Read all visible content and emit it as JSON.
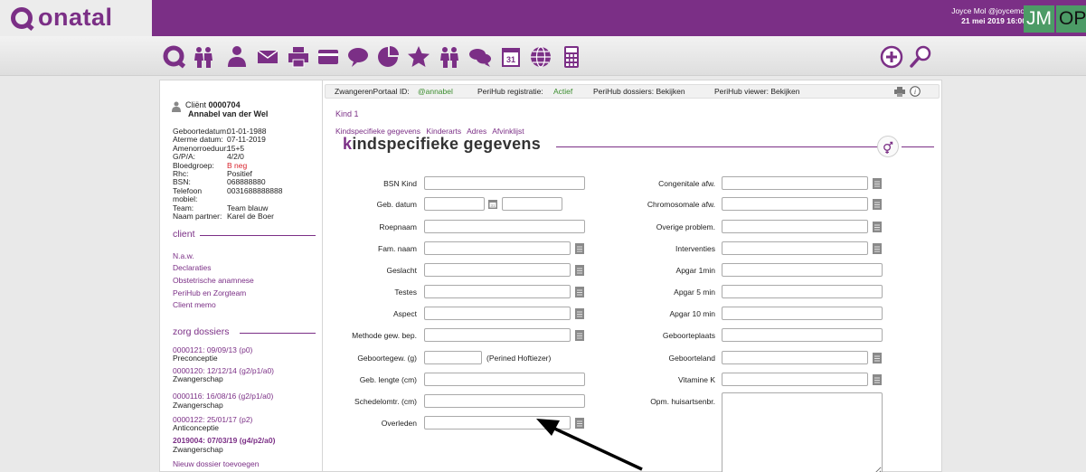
{
  "app": {
    "logo_text": "onatal"
  },
  "user": {
    "name": "Joyce Mol @joycemol",
    "datetime": "21 mei 2019 16:00",
    "initials": "JM",
    "app_badge": "OP"
  },
  "toolbar_icons": [
    "home-q-icon",
    "pregnant-women-icon",
    "client-person-icon",
    "mail-icon",
    "print-icon",
    "card-icon",
    "chat-bubble-icon",
    "pie-chart-icon",
    "star-icon",
    "people-icon",
    "chat-icon",
    "calendar-icon",
    "globe-icon",
    "calculator-icon",
    "add-circle-icon",
    "search-icon"
  ],
  "client": {
    "label": "Cliënt",
    "number": "0000704",
    "name": "Annabel van der Wel",
    "fields": [
      {
        "label": "Geboortedatum:",
        "value": "01-01-1988"
      },
      {
        "label": "Aterme datum:",
        "value": "07-11-2019"
      },
      {
        "label": "Amenorroeduur:",
        "value": "15+5"
      },
      {
        "label": "G/P/A:",
        "value": "4/2/0"
      },
      {
        "label": "Bloedgroep:",
        "value": "B neg",
        "highlight": "#d8222c"
      },
      {
        "label": "Rhc:",
        "value": "Positief"
      },
      {
        "label": "BSN:",
        "value": "068888880"
      },
      {
        "label": "Telefoon mobiel:",
        "value": "0031688888888"
      },
      {
        "label": "Team:",
        "value": "Team blauw"
      },
      {
        "label": "Naam partner:",
        "value": "Karel de Boer"
      }
    ]
  },
  "sidebar": {
    "client_section": "client",
    "client_links": [
      "N.a.w.",
      "Declaraties",
      "Obstetrische anamnese",
      "PeriHub en Zorgteam",
      "Client memo"
    ],
    "dossiers_section": "zorg dossiers",
    "dossiers": [
      {
        "id": "0000121: 09/09/13 (p0)",
        "type": "Preconceptie"
      },
      {
        "id": "0000120: 12/12/14 (g2/p1/a0)",
        "type": "Zwangerschap"
      },
      {
        "id": "0000116: 16/08/16 (g2/p1/a0)",
        "type": "Zwangerschap"
      },
      {
        "id": "0000122: 25/01/17 (p2)",
        "type": "Anticonceptie"
      },
      {
        "id": "2019004: 07/03/19 (g4/p2/a0)",
        "type": "Zwangerschap",
        "active": true
      }
    ],
    "new_dossier": "Nieuw dossier toevoegen"
  },
  "statusbar": {
    "portal_label": "ZwangerenPortaal ID:",
    "portal_value": "@annabel",
    "reg_label": "PeriHub registratie:",
    "reg_value": "Actief",
    "dossiers_label": "PeriHub dossiers: Bekijken",
    "viewer_label": "PeriHub viewer: Bekijken"
  },
  "content": {
    "kind_title": "Kind 1",
    "subnav": [
      "Kindspecifieke gegevens",
      "Kinderarts",
      "Adres",
      "Afvinklijst"
    ],
    "title_first": "k",
    "title_rest": "indspecifieke gegevens",
    "left_labels": [
      "BSN Kind",
      "Geb. datum",
      "Roepnaam",
      "Fam. naam",
      "Geslacht",
      "Testes",
      "Aspect",
      "Methode gew. bep.",
      "Geboortegew. (g)",
      "Geb. lengte (cm)",
      "Schedelomtr. (cm)",
      "Overleden"
    ],
    "birthweight_note": "(Perined Hoftiezer)",
    "right_labels": [
      "Congenitale afw.",
      "Chromosomale afw.",
      "Overige problem.",
      "Interventies",
      "Apgar 1min",
      "Apgar 5 min",
      "Apgar 10 min",
      "Geboorteplaats",
      "Geboorteland",
      "Vitamine K",
      "Opm. huisartsenbr."
    ]
  },
  "colors": {
    "brand": "#7b2f86",
    "badge_green": "#4c9b66",
    "alert_red": "#d8222c",
    "active_green": "#3b8d2e"
  }
}
